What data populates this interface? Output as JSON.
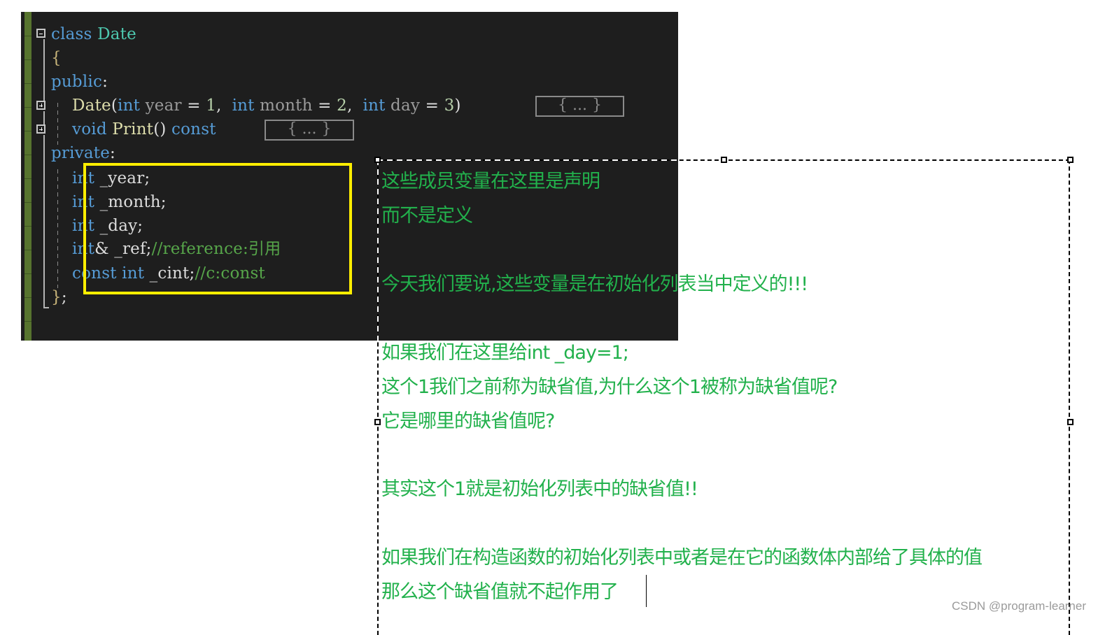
{
  "editor": {
    "lines": [
      {
        "tokens": [
          [
            "kw",
            "class"
          ],
          [
            "pl",
            " "
          ],
          [
            "ty",
            "Date"
          ]
        ]
      },
      {
        "tokens": [
          [
            "br",
            "{"
          ]
        ]
      },
      {
        "tokens": [
          [
            "kw",
            "public"
          ],
          [
            "pl",
            ":"
          ]
        ]
      },
      {
        "tokens": [
          [
            "pl",
            "    "
          ],
          [
            "fn",
            "Date"
          ],
          [
            "pl",
            "("
          ],
          [
            "kw",
            "int"
          ],
          [
            "pm",
            " year"
          ],
          [
            "pl",
            " = "
          ],
          [
            "num",
            "1"
          ],
          [
            "pl",
            ",  "
          ],
          [
            "kw",
            "int"
          ],
          [
            "pm",
            " month"
          ],
          [
            "pl",
            " = "
          ],
          [
            "num",
            "2"
          ],
          [
            "pl",
            ",  "
          ],
          [
            "kw",
            "int"
          ],
          [
            "pm",
            " day"
          ],
          [
            "pl",
            " = "
          ],
          [
            "num",
            "3"
          ],
          [
            "pl",
            ")"
          ]
        ]
      },
      {
        "tokens": [
          [
            "pl",
            "    "
          ],
          [
            "kw",
            "void"
          ],
          [
            "pl",
            " "
          ],
          [
            "fn",
            "Print"
          ],
          [
            "pl",
            "() "
          ],
          [
            "kw",
            "const"
          ]
        ]
      },
      {
        "tokens": [
          [
            "kw",
            "private"
          ],
          [
            "pl",
            ":"
          ]
        ]
      },
      {
        "tokens": [
          [
            "pl",
            "    "
          ],
          [
            "kw",
            "int"
          ],
          [
            "pl",
            " _year;"
          ]
        ]
      },
      {
        "tokens": [
          [
            "pl",
            "    "
          ],
          [
            "kw",
            "int"
          ],
          [
            "pl",
            " _month;"
          ]
        ]
      },
      {
        "tokens": [
          [
            "pl",
            "    "
          ],
          [
            "kw",
            "int"
          ],
          [
            "pl",
            " _day;"
          ]
        ]
      },
      {
        "tokens": [
          [
            "pl",
            "    "
          ],
          [
            "kw",
            "int"
          ],
          [
            "pl",
            "& _ref;"
          ],
          [
            "cm",
            "//reference:引用"
          ]
        ]
      },
      {
        "tokens": [
          [
            "pl",
            "    "
          ],
          [
            "kw",
            "const"
          ],
          [
            "pl",
            " "
          ],
          [
            "kw",
            "int"
          ],
          [
            "pl",
            " _cint;"
          ],
          [
            "cm",
            "//c:const"
          ]
        ]
      },
      {
        "tokens": [
          [
            "br",
            "}"
          ],
          [
            "pl",
            ";"
          ]
        ]
      }
    ],
    "collapsed_label": "{ ... }",
    "fold_icons": {
      "class": "collapse",
      "ctor": "expand",
      "print": "expand"
    }
  },
  "annotation": {
    "lines": [
      "这些成员变量在这里是声明",
      "而不是定义",
      "今天我们要说,这些变量是在初始化列表当中定义的!!!",
      "如果我们在这里给int _day=1;",
      "这个1我们之前称为缺省值,为什么这个1被称为缺省值呢?",
      "它是哪里的缺省值呢?",
      "其实这个1就是初始化列表中的缺省值!!",
      "如果我们在构造函数的初始化列表中或者是在它的函数体内部给了具体的值",
      "那么这个缺省值就不起作用了"
    ],
    "text_color": "#22b14c"
  },
  "highlight_color": "#ffee00",
  "watermark": "CSDN @program-learner"
}
